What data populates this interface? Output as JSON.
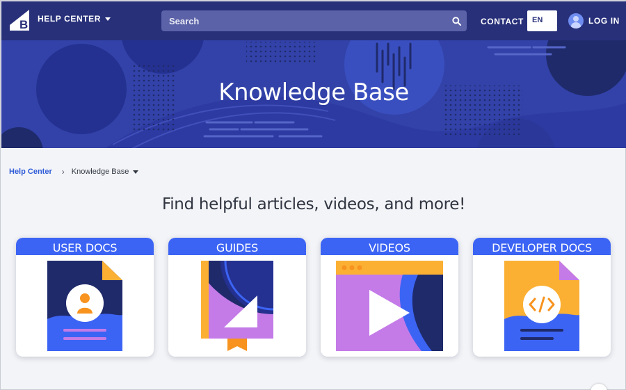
{
  "nav": {
    "help_center_label": "HELP CENTER",
    "search_placeholder": "Search",
    "contact_label": "CONTACT",
    "language": "EN",
    "login_label": "LOG IN"
  },
  "hero": {
    "title": "Knowledge Base"
  },
  "breadcrumb": {
    "home": "Help Center",
    "separator": "›",
    "current": "Knowledge Base"
  },
  "tagline": "Find helpful articles, videos, and more!",
  "cards": [
    {
      "title": "USER DOCS",
      "icon": "user-document-icon"
    },
    {
      "title": "GUIDES",
      "icon": "guide-book-icon"
    },
    {
      "title": "VIDEOS",
      "icon": "video-player-icon"
    },
    {
      "title": "DEVELOPER DOCS",
      "icon": "code-document-icon"
    }
  ],
  "colors": {
    "nav_bg": "#28307a",
    "hero_bg": "#3242a8",
    "card_header": "#3c64f4",
    "link": "#2f5bd8",
    "accent_orange": "#f7931e",
    "accent_yellow": "#fbb034",
    "accent_purple": "#c47be8",
    "navy": "#1f2a6b"
  }
}
